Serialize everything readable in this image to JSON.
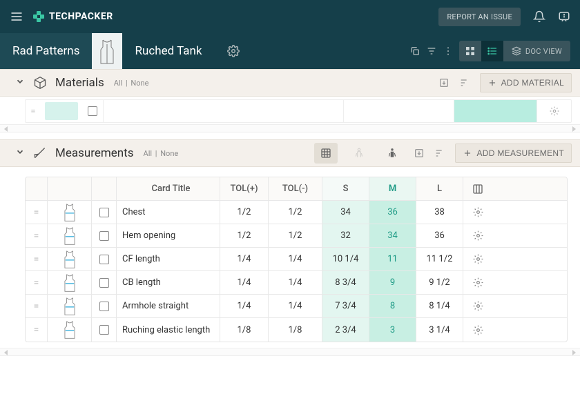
{
  "topbar": {
    "brand": "TECHPACKER",
    "report_label": "REPORT AN ISSUE"
  },
  "breadcrumb": "Rad Patterns",
  "product_title": "Ruched Tank",
  "doc_view_label": "DOC VIEW",
  "materials": {
    "title": "Materials",
    "filter_all": "All",
    "filter_none": "None",
    "add_label": "ADD MATERIAL"
  },
  "measurements": {
    "title": "Measurements",
    "filter_all": "All",
    "filter_none": "None",
    "add_label": "ADD MEASUREMENT",
    "columns": {
      "card_title": "Card Title",
      "tol_plus": "TOL(+)",
      "tol_minus": "TOL(-)",
      "s": "S",
      "m": "M",
      "l": "L"
    },
    "rows": [
      {
        "title": "Chest",
        "tol_plus": "1/2",
        "tol_minus": "1/2",
        "s": "34",
        "m": "36",
        "l": "38"
      },
      {
        "title": "Hem opening",
        "tol_plus": "1/2",
        "tol_minus": "1/2",
        "s": "32",
        "m": "34",
        "l": "36"
      },
      {
        "title": "CF length",
        "tol_plus": "1/4",
        "tol_minus": "1/4",
        "s": "10 1/4",
        "m": "11",
        "l": "11 1/2"
      },
      {
        "title": "CB length",
        "tol_plus": "1/4",
        "tol_minus": "1/4",
        "s": "8 3/4",
        "m": "9",
        "l": "9 1/2"
      },
      {
        "title": "Armhole straight",
        "tol_plus": "1/4",
        "tol_minus": "1/4",
        "s": "7 3/4",
        "m": "8",
        "l": "8 1/4"
      },
      {
        "title": "Ruching elastic length",
        "tol_plus": "1/8",
        "tol_minus": "1/8",
        "s": "2 3/4",
        "m": "3",
        "l": "3 1/4"
      }
    ]
  }
}
